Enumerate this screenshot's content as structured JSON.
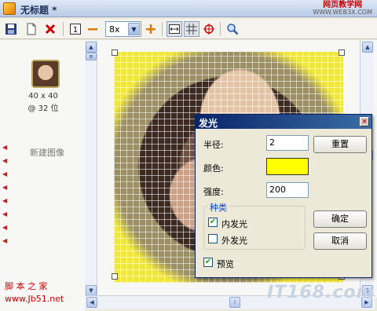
{
  "window": {
    "title": "无标题 *"
  },
  "watermark_top": {
    "line1": "网页教学网",
    "line2": "WWW.WEB3X.COM"
  },
  "toolbar": {
    "zoom_value": "8x",
    "one_label": "1"
  },
  "left_panel": {
    "thumb_size": "40 x 40",
    "thumb_bits": "@ 32 位",
    "new_image": "新建图像",
    "site_watermark_1": "脚 本 之 家",
    "site_watermark_2": "www.Jb51.net"
  },
  "bottom_watermark": "IT168.com",
  "dialog": {
    "title": "发光",
    "radius_label": "半径:",
    "radius_value": "2",
    "color_label": "颜色:",
    "color_value": "#ffff00",
    "strength_label": "强度:",
    "strength_value": "200",
    "reset_label": "重置",
    "group_title": "种类",
    "inner_glow_label": "内发光",
    "inner_glow_checked": true,
    "outer_glow_label": "外发光",
    "outer_glow_checked": false,
    "preview_label": "预览",
    "preview_checked": true,
    "ok_label": "确定",
    "cancel_label": "取消"
  }
}
